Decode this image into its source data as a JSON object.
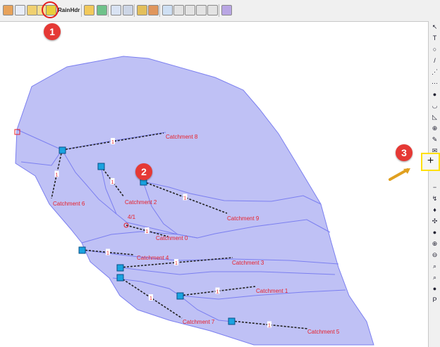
{
  "toolbar": {
    "buttons": [
      {
        "icon": "globe-icon",
        "color": "#c87830"
      },
      {
        "icon": "map-icon",
        "color": "#3a7bd5"
      },
      {
        "icon": "layer-icon",
        "color": "#d0a020"
      },
      {
        "icon": "grid-icon",
        "color": "#e8c040"
      },
      {
        "icon": "subcatchment-icon",
        "color": "#d8b820"
      }
    ],
    "text_buttons": [
      "Rain",
      "Hdr"
    ]
  },
  "map": {
    "catchment_color": "#bfc1f5",
    "boundary_color": "#7b7ff0",
    "node_color": "#1aa3e0",
    "link_color": "#222222",
    "label_color": "#e8202a",
    "labels": {
      "catchment_8": "Catchment 8",
      "catchment_6": "Catchment 6",
      "catchment_2": "Catchment 2",
      "catchment_9": "Catchment 9",
      "catchment_0": "Catchment 0",
      "catchment_4": "Catchment 4",
      "catchment_3": "Catchment 3",
      "catchment_1": "Catchment 1",
      "catchment_7": "Catchment 7",
      "catchment_5": "Catchment 5",
      "node_4_1": "4/1"
    },
    "link_ids": [
      "1",
      "1",
      "1",
      "1",
      "1",
      "1",
      "1",
      "1",
      "1",
      "1"
    ]
  },
  "annotations": {
    "badge_1": "1",
    "badge_2": "2",
    "badge_3": "3",
    "highlight_symbol": "+"
  },
  "sidebar": {
    "tools": [
      "↖",
      "T",
      "○",
      "/",
      "⋰",
      "⋯",
      "●",
      "◡",
      "◺",
      "⊕",
      "✎",
      "✉",
      "+",
      "−",
      "↯",
      "♦",
      "✣",
      "●",
      "⊕",
      "⊖",
      "⌕",
      "⌕",
      "●",
      "P"
    ]
  }
}
